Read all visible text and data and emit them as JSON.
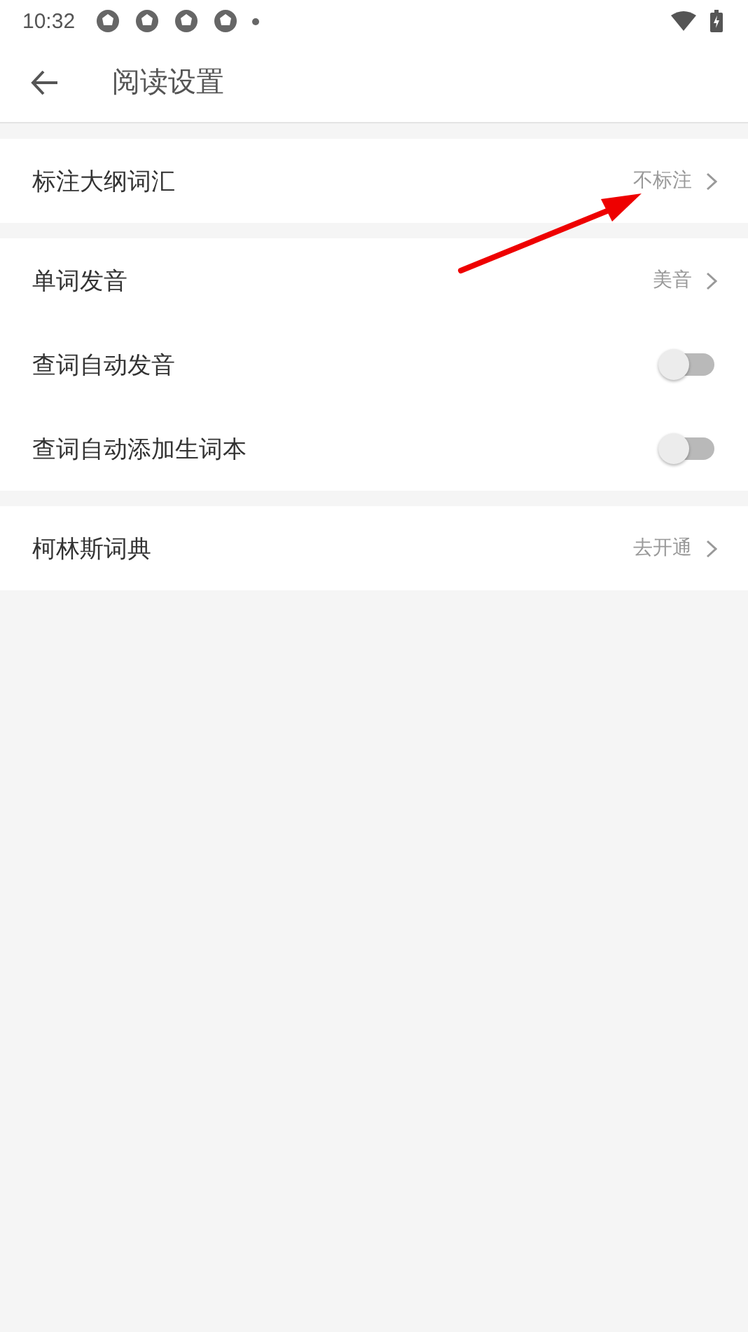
{
  "status_bar": {
    "time": "10:32"
  },
  "toolbar": {
    "title": "阅读设置"
  },
  "sections": [
    {
      "rows": [
        {
          "kind": "link",
          "label": "标注大纲词汇",
          "value": "不标注"
        }
      ]
    },
    {
      "rows": [
        {
          "kind": "link",
          "label": "单词发音",
          "value": "美音"
        },
        {
          "kind": "switch",
          "label": "查词自动发音",
          "on": false
        },
        {
          "kind": "switch",
          "label": "查词自动添加生词本",
          "on": false
        }
      ]
    },
    {
      "rows": [
        {
          "kind": "link",
          "label": "柯林斯词典",
          "value": "去开通"
        }
      ]
    }
  ]
}
